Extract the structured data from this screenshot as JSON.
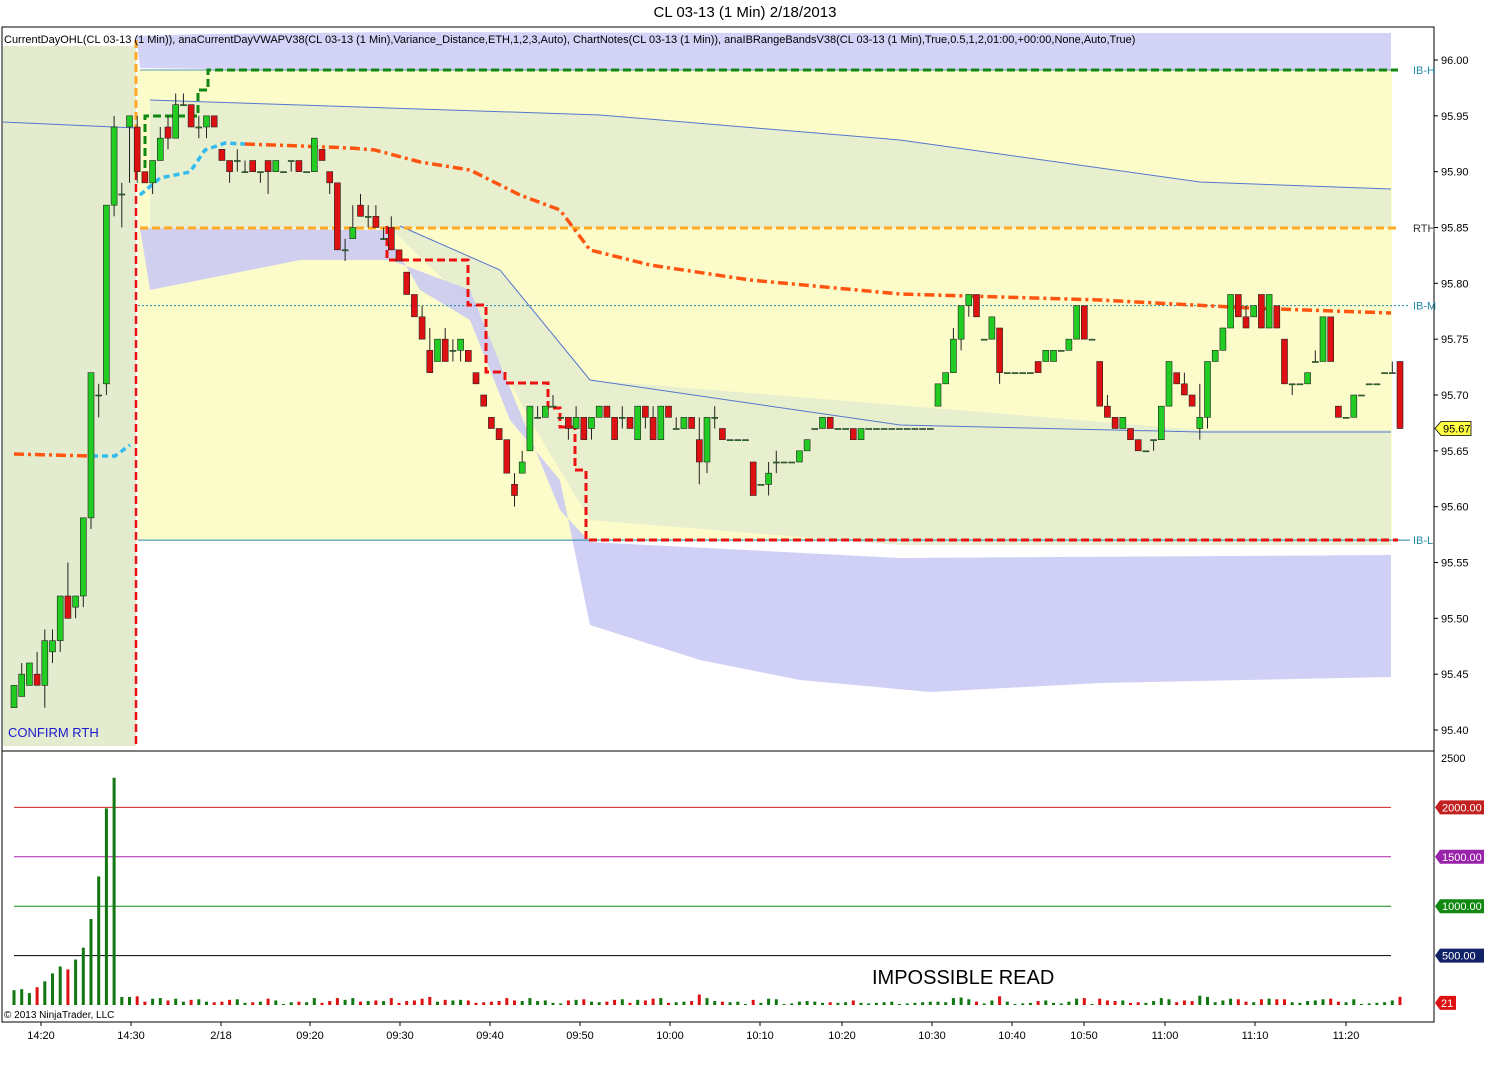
{
  "title": "CL 03-13 (1 Min)  2/18/2013",
  "indicator_text": "CurrentDayOHL(CL 03-13 (1 Min)), anaCurrentDayVWAPV38(CL 03-13 (1 Min),Variance_Distance,ETH,1,2,3,Auto), ChartNotes(CL 03-13 (1 Min)), anaIBRangeBandsV38(CL 03-13 (1 Min),True,0.5,1,2,01:00,+00:00,None,Auto,True)",
  "confirm_label": "CONFIRM RTH",
  "annotation": "IMPOSSIBLE READ",
  "copyright": "© 2013 NinjaTrader, LLC",
  "level_labels": [
    "IB-H",
    "RTH",
    "IB-M",
    "IB-L"
  ],
  "current_price_label": "95.67",
  "colors": {
    "up": "#22cc22",
    "down": "#dd1111",
    "vwap": "#ff5511",
    "ib_high": "#118811",
    "ib_low": "#ee1111",
    "rth": "#ffaa22",
    "band": "#c8c8f5",
    "inner": "#e4ecd0",
    "yellow": "#fcfccb"
  },
  "chart_data": [
    {
      "type": "candlestick",
      "ylim": [
        95.38,
        96.03
      ],
      "yticks": [
        "96.00",
        "95.95",
        "95.90",
        "95.85",
        "95.80",
        "95.75",
        "95.70",
        "95.65",
        "95.60",
        "95.55",
        "95.50",
        "95.45",
        "95.40"
      ],
      "xticks": [
        "14:20",
        "14:30",
        "2/18",
        "09:20",
        "09:30",
        "09:40",
        "09:50",
        "10:00",
        "10:10",
        "10:20",
        "10:30",
        "10:40",
        "10:50",
        "11:00",
        "11:10",
        "11:20"
      ],
      "levels": {
        "IB-H": 95.99,
        "RTH": 95.85,
        "IB-M": 95.78,
        "IB-L": 95.57,
        "last": 95.67
      },
      "ohlc": [
        [
          95.42,
          95.44,
          95.42,
          95.44
        ],
        [
          95.43,
          95.46,
          95.43,
          95.45
        ],
        [
          95.44,
          95.46,
          95.44,
          95.46
        ],
        [
          95.45,
          95.47,
          95.44,
          95.44
        ],
        [
          95.44,
          95.49,
          95.42,
          95.48
        ],
        [
          95.47,
          95.49,
          95.46,
          95.48
        ],
        [
          95.48,
          95.52,
          95.47,
          95.52
        ],
        [
          95.52,
          95.55,
          95.5,
          95.5
        ],
        [
          95.51,
          95.52,
          95.5,
          95.52
        ],
        [
          95.52,
          95.59,
          95.51,
          95.59
        ],
        [
          95.59,
          95.72,
          95.58,
          95.72
        ],
        [
          95.7,
          95.71,
          95.68,
          95.7
        ],
        [
          95.71,
          95.87,
          95.7,
          95.87
        ],
        [
          95.87,
          95.95,
          95.86,
          95.94
        ],
        [
          95.88,
          95.89,
          95.85,
          95.88
        ],
        [
          95.94,
          95.95,
          95.89,
          95.95
        ],
        [
          95.94,
          95.95,
          95.89,
          95.9
        ],
        [
          95.9,
          95.9,
          95.89,
          95.89
        ],
        [
          95.89,
          95.91,
          95.88,
          95.91
        ],
        [
          95.91,
          95.94,
          95.91,
          95.93
        ],
        [
          95.94,
          95.95,
          95.92,
          95.93
        ],
        [
          95.93,
          95.97,
          95.93,
          95.96
        ],
        [
          95.96,
          95.97,
          95.96,
          95.96
        ],
        [
          95.96,
          95.96,
          95.94,
          95.94
        ],
        [
          95.94,
          95.95,
          95.93,
          95.94
        ],
        [
          95.94,
          95.95,
          95.93,
          95.95
        ],
        [
          95.95,
          95.95,
          95.94,
          95.94
        ],
        [
          95.92,
          95.92,
          95.91,
          95.91
        ],
        [
          95.91,
          95.91,
          95.89,
          95.9
        ],
        [
          95.91,
          95.92,
          95.9,
          95.91
        ],
        [
          95.9,
          95.91,
          95.9,
          95.9
        ],
        [
          95.91,
          95.91,
          95.9,
          95.9
        ],
        [
          95.9,
          95.9,
          95.89,
          95.9
        ],
        [
          95.91,
          95.91,
          95.88,
          95.9
        ],
        [
          95.9,
          95.91,
          95.9,
          95.91
        ],
        [
          95.9,
          95.9,
          95.9,
          95.9
        ],
        [
          95.91,
          95.91,
          95.9,
          95.91
        ],
        [
          95.91,
          95.91,
          95.9,
          95.9
        ],
        [
          95.9,
          95.9,
          95.9,
          95.9
        ],
        [
          95.9,
          95.93,
          95.9,
          95.93
        ],
        [
          95.92,
          95.92,
          95.91,
          95.91
        ],
        [
          95.9,
          95.9,
          95.88,
          95.89
        ],
        [
          95.89,
          95.89,
          95.85,
          95.83
        ],
        [
          95.83,
          95.84,
          95.82,
          95.83
        ],
        [
          95.84,
          95.87,
          95.84,
          95.85
        ],
        [
          95.87,
          95.88,
          95.86,
          95.86
        ],
        [
          95.86,
          95.87,
          95.85,
          95.86
        ],
        [
          95.86,
          95.87,
          95.85,
          95.85
        ],
        [
          95.84,
          95.85,
          95.84,
          95.84
        ],
        [
          95.85,
          95.86,
          95.83,
          95.83
        ],
        [
          95.83,
          95.83,
          95.82,
          95.82
        ],
        [
          95.81,
          95.81,
          95.79,
          95.79
        ],
        [
          95.79,
          95.79,
          95.77,
          95.77
        ],
        [
          95.77,
          95.78,
          95.75,
          95.75
        ],
        [
          95.74,
          95.76,
          95.72,
          95.72
        ],
        [
          95.73,
          95.75,
          95.73,
          95.75
        ],
        [
          95.75,
          95.76,
          95.73,
          95.73
        ],
        [
          95.74,
          95.75,
          95.73,
          95.74
        ],
        [
          95.74,
          95.75,
          95.73,
          95.75
        ],
        [
          95.74,
          95.74,
          95.73,
          95.73
        ],
        [
          95.72,
          95.72,
          95.71,
          95.71
        ],
        [
          95.7,
          95.7,
          95.69,
          95.69
        ],
        [
          95.68,
          95.68,
          95.67,
          95.67
        ],
        [
          95.67,
          95.67,
          95.66,
          95.66
        ],
        [
          95.66,
          95.66,
          95.63,
          95.63
        ],
        [
          95.62,
          95.63,
          95.6,
          95.61
        ],
        [
          95.63,
          95.65,
          95.63,
          95.64
        ],
        [
          95.65,
          95.69,
          95.65,
          95.69
        ],
        [
          95.68,
          95.69,
          95.68,
          95.68
        ],
        [
          95.68,
          95.69,
          95.68,
          95.69
        ],
        [
          95.69,
          95.7,
          95.69,
          95.69
        ],
        [
          95.68,
          95.68,
          95.68,
          95.68
        ],
        [
          95.68,
          95.68,
          95.66,
          95.67
        ],
        [
          95.67,
          95.69,
          95.67,
          95.68
        ],
        [
          95.68,
          95.68,
          95.66,
          95.66
        ],
        [
          95.67,
          95.68,
          95.66,
          95.68
        ],
        [
          95.68,
          95.69,
          95.68,
          95.69
        ],
        [
          95.69,
          95.69,
          95.68,
          95.68
        ],
        [
          95.68,
          95.68,
          95.66,
          95.66
        ],
        [
          95.68,
          95.69,
          95.67,
          95.68
        ],
        [
          95.68,
          95.68,
          95.67,
          95.67
        ],
        [
          95.66,
          95.69,
          95.66,
          95.69
        ],
        [
          95.69,
          95.69,
          95.67,
          95.68
        ],
        [
          95.68,
          95.69,
          95.66,
          95.66
        ],
        [
          95.66,
          95.69,
          95.66,
          95.69
        ],
        [
          95.69,
          95.69,
          95.68,
          95.68
        ],
        [
          95.67,
          95.68,
          95.67,
          95.67
        ],
        [
          95.67,
          95.68,
          95.67,
          95.68
        ],
        [
          95.68,
          95.68,
          95.67,
          95.67
        ],
        [
          95.66,
          95.68,
          95.62,
          95.64
        ],
        [
          95.64,
          95.68,
          95.63,
          95.68
        ],
        [
          95.68,
          95.69,
          95.67,
          95.68
        ],
        [
          95.67,
          95.67,
          95.66,
          95.66
        ],
        [
          95.66,
          95.66,
          95.66,
          95.66
        ],
        [
          95.66,
          95.66,
          95.66,
          95.66
        ],
        [
          95.66,
          95.66,
          95.66,
          95.66
        ],
        [
          95.64,
          95.64,
          95.61,
          95.61
        ],
        [
          95.62,
          95.62,
          95.62,
          95.62
        ],
        [
          95.62,
          95.64,
          95.61,
          95.63
        ],
        [
          95.64,
          95.65,
          95.63,
          95.64
        ],
        [
          95.64,
          95.64,
          95.64,
          95.64
        ],
        [
          95.64,
          95.64,
          95.64,
          95.64
        ],
        [
          95.64,
          95.65,
          95.64,
          95.65
        ],
        [
          95.65,
          95.66,
          95.65,
          95.66
        ],
        [
          95.67,
          95.67,
          95.67,
          95.67
        ],
        [
          95.67,
          95.68,
          95.67,
          95.68
        ],
        [
          95.68,
          95.68,
          95.67,
          95.67
        ],
        [
          95.67,
          95.67,
          95.67,
          95.67
        ],
        [
          95.67,
          95.67,
          95.67,
          95.67
        ],
        [
          95.67,
          95.67,
          95.66,
          95.66
        ],
        [
          95.66,
          95.67,
          95.66,
          95.67
        ],
        [
          95.67,
          95.67,
          95.67,
          95.67
        ],
        [
          95.67,
          95.67,
          95.67,
          95.67
        ],
        [
          95.67,
          95.67,
          95.67,
          95.67
        ],
        [
          95.67,
          95.67,
          95.67,
          95.67
        ],
        [
          95.67,
          95.67,
          95.67,
          95.67
        ],
        [
          95.67,
          95.67,
          95.67,
          95.67
        ],
        [
          95.67,
          95.67,
          95.67,
          95.67
        ],
        [
          95.67,
          95.67,
          95.67,
          95.67
        ],
        [
          95.67,
          95.67,
          95.67,
          95.67
        ],
        [
          95.69,
          95.71,
          95.69,
          95.71
        ],
        [
          95.71,
          95.72,
          95.71,
          95.72
        ],
        [
          95.72,
          95.76,
          95.72,
          95.75
        ],
        [
          95.75,
          95.78,
          95.74,
          95.78
        ],
        [
          95.78,
          95.79,
          95.77,
          95.79
        ],
        [
          95.79,
          95.79,
          95.77,
          95.77
        ],
        [
          95.75,
          95.75,
          95.75,
          95.75
        ],
        [
          95.75,
          95.77,
          95.75,
          95.77
        ],
        [
          95.76,
          95.76,
          95.71,
          95.72
        ],
        [
          95.72,
          95.72,
          95.72,
          95.72
        ],
        [
          95.72,
          95.72,
          95.72,
          95.72
        ],
        [
          95.72,
          95.72,
          95.72,
          95.72
        ],
        [
          95.72,
          95.72,
          95.72,
          95.72
        ],
        [
          95.73,
          95.73,
          95.72,
          95.72
        ],
        [
          95.73,
          95.74,
          95.73,
          95.74
        ],
        [
          95.73,
          95.74,
          95.73,
          95.74
        ],
        [
          95.74,
          95.74,
          95.74,
          95.74
        ],
        [
          95.74,
          95.75,
          95.74,
          95.75
        ],
        [
          95.75,
          95.78,
          95.75,
          95.78
        ],
        [
          95.78,
          95.78,
          95.75,
          95.75
        ],
        [
          95.75,
          95.75,
          95.75,
          95.75
        ],
        [
          95.73,
          95.73,
          95.69,
          95.69
        ],
        [
          95.69,
          95.7,
          95.68,
          95.68
        ],
        [
          95.68,
          95.68,
          95.67,
          95.67
        ],
        [
          95.67,
          95.68,
          95.67,
          95.68
        ],
        [
          95.67,
          95.67,
          95.66,
          95.66
        ],
        [
          95.66,
          95.66,
          95.65,
          95.65
        ],
        [
          95.65,
          95.65,
          95.65,
          95.65
        ],
        [
          95.66,
          95.66,
          95.65,
          95.66
        ],
        [
          95.66,
          95.69,
          95.66,
          95.69
        ],
        [
          95.69,
          95.73,
          95.69,
          95.73
        ],
        [
          95.72,
          95.72,
          95.71,
          95.71
        ],
        [
          95.71,
          95.72,
          95.7,
          95.7
        ],
        [
          95.7,
          95.7,
          95.69,
          95.69
        ],
        [
          95.67,
          95.71,
          95.66,
          95.68
        ],
        [
          95.68,
          95.73,
          95.67,
          95.73
        ],
        [
          95.73,
          95.74,
          95.73,
          95.74
        ],
        [
          95.74,
          95.76,
          95.74,
          95.76
        ],
        [
          95.76,
          95.79,
          95.76,
          95.79
        ],
        [
          95.79,
          95.79,
          95.77,
          95.77
        ],
        [
          95.77,
          95.78,
          95.76,
          95.76
        ],
        [
          95.77,
          95.78,
          95.77,
          95.78
        ],
        [
          95.79,
          95.79,
          95.76,
          95.76
        ],
        [
          95.76,
          95.79,
          95.76,
          95.79
        ],
        [
          95.78,
          95.78,
          95.76,
          95.76
        ],
        [
          95.75,
          95.75,
          95.71,
          95.71
        ],
        [
          95.71,
          95.71,
          95.7,
          95.71
        ],
        [
          95.71,
          95.71,
          95.71,
          95.71
        ],
        [
          95.71,
          95.72,
          95.71,
          95.72
        ],
        [
          95.73,
          95.74,
          95.73,
          95.73
        ],
        [
          95.73,
          95.77,
          95.73,
          95.77
        ],
        [
          95.77,
          95.77,
          95.73,
          95.73
        ],
        [
          95.69,
          95.69,
          95.68,
          95.68
        ],
        [
          95.68,
          95.68,
          95.68,
          95.68
        ],
        [
          95.68,
          95.7,
          95.68,
          95.7
        ],
        [
          95.7,
          95.7,
          95.7,
          95.7
        ],
        [
          95.71,
          95.71,
          95.71,
          95.71
        ],
        [
          95.71,
          95.71,
          95.71,
          95.71
        ],
        [
          95.72,
          95.72,
          95.72,
          95.72
        ],
        [
          95.72,
          95.73,
          95.72,
          95.72
        ],
        [
          95.73,
          95.73,
          95.67,
          95.67
        ]
      ],
      "volume_levels": [
        500,
        1000,
        1500,
        2000
      ],
      "volume_ylim": [
        0,
        2500
      ],
      "volume_last": 21
    }
  ],
  "volume_labels": {
    "y2500": "2500",
    "v2000": "2000.00",
    "v1500": "1500.00",
    "v1000": "1000.00",
    "v500": "500.00",
    "last": "21"
  }
}
